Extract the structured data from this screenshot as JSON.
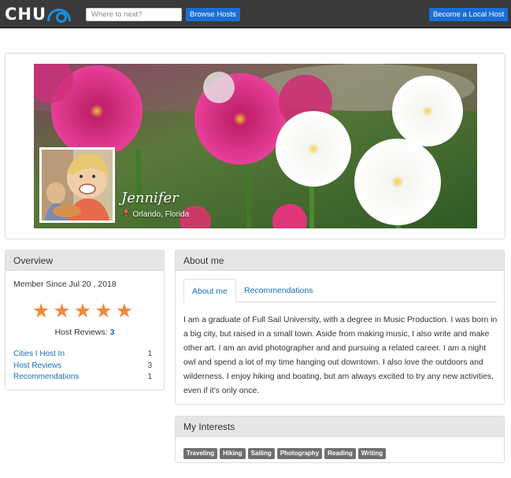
{
  "nav": {
    "logo_text": "CHU",
    "search_placeholder": "Where to next?",
    "browse_label": "Browse Hosts",
    "become_host_label": "Become a Local Host"
  },
  "profile": {
    "name": "Jennifer",
    "location": "Orlando, Florida"
  },
  "overview": {
    "title": "Overview",
    "member_since": "Member Since Jul 20 , 2018",
    "rating": 5,
    "reviews_label": "Host Reviews:",
    "reviews_count": "3",
    "stats": [
      {
        "label": "Cities I Host In",
        "value": "1"
      },
      {
        "label": "Host Reviews",
        "value": "3"
      },
      {
        "label": "Recommendations",
        "value": "1"
      }
    ]
  },
  "about": {
    "title": "About me",
    "tabs": [
      "About me",
      "Recommendations"
    ],
    "text": "I am a graduate of Full Sail University, with a degree in Music Production. I was born in a big city, but raised in a small town. Aside from making music, I also write and make other art. I am an avid photographer and and pursuing a related career. I am a night owl and spend a lot of my time hanging out downtown. I also love the outdoors and wilderness. I enjoy hiking and boating, but am always excited to try any new activities, even if it's only once."
  },
  "interests": {
    "title": "My Interests",
    "tags": [
      "Traveling",
      "Hiking",
      "Sailing",
      "Photography",
      "Reading",
      "Writing"
    ]
  },
  "colors": {
    "nav_bg": "#3a3a3a",
    "accent_blue": "#1a6fd6",
    "link_blue": "#1a6fb8",
    "star_orange": "#f0883a",
    "tag_gray": "#6f6f6f"
  }
}
